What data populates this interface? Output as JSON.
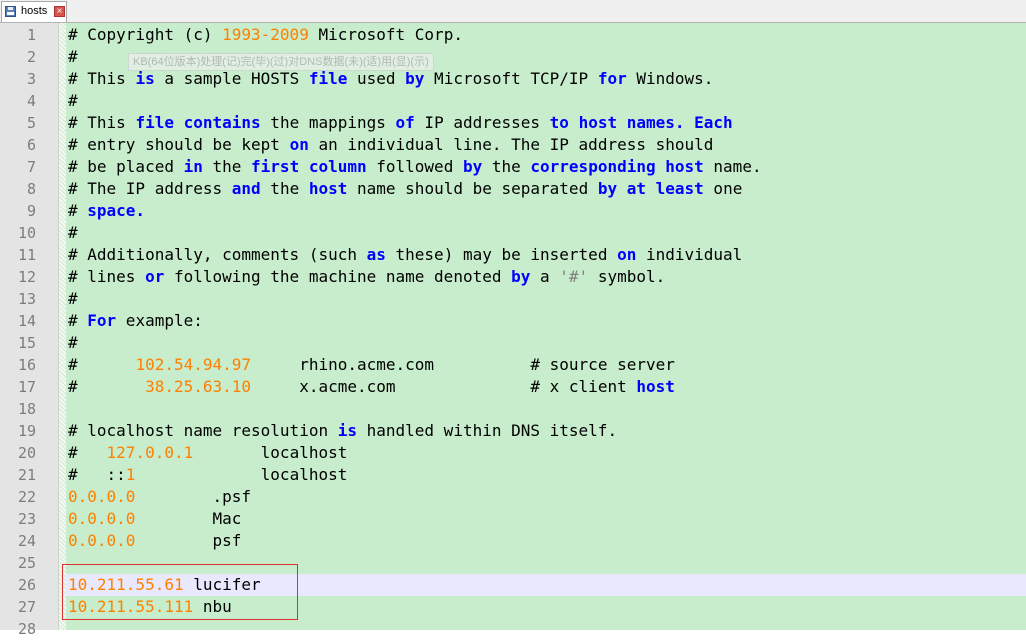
{
  "tab": {
    "title": "hosts",
    "close_glyph": "×"
  },
  "tooltip": "KB(64位版本)处理(记)完(毕)(过)对DNS数据(未)(适)用(显)(示)",
  "colors": {
    "editor_bg": "#c7edcc",
    "gutter_bg": "#e4e4e4",
    "keyword": "#0000ff",
    "number": "#ff8000",
    "highlight_line": "#e8e8ff",
    "annotation_box": "#e03030"
  },
  "lines": [
    {
      "n": "1",
      "segs": [
        [
          "t",
          "# Copyright (c) "
        ],
        [
          "num",
          "1993-2009"
        ],
        [
          "t",
          " Microsoft Corp."
        ]
      ]
    },
    {
      "n": "2",
      "segs": [
        [
          "t",
          "#"
        ]
      ]
    },
    {
      "n": "3",
      "segs": [
        [
          "t",
          "# This "
        ],
        [
          "kw",
          "is"
        ],
        [
          "t",
          " a sample HOSTS "
        ],
        [
          "kw",
          "file"
        ],
        [
          "t",
          " used "
        ],
        [
          "kw",
          "by"
        ],
        [
          "t",
          " Microsoft TCP/IP "
        ],
        [
          "kw",
          "for"
        ],
        [
          "t",
          " Windows."
        ]
      ]
    },
    {
      "n": "4",
      "segs": [
        [
          "t",
          "#"
        ]
      ]
    },
    {
      "n": "5",
      "segs": [
        [
          "t",
          "# This "
        ],
        [
          "kw",
          "file contains"
        ],
        [
          "t",
          " the mappings "
        ],
        [
          "kw",
          "of"
        ],
        [
          "t",
          " IP addresses "
        ],
        [
          "kw",
          "to"
        ],
        [
          "t",
          " "
        ],
        [
          "kw",
          "host names. Each"
        ]
      ]
    },
    {
      "n": "6",
      "segs": [
        [
          "t",
          "# entry should be kept "
        ],
        [
          "kw",
          "on"
        ],
        [
          "t",
          " an individual line. The IP address should"
        ]
      ]
    },
    {
      "n": "7",
      "segs": [
        [
          "t",
          "# be placed "
        ],
        [
          "kw",
          "in"
        ],
        [
          "t",
          " the "
        ],
        [
          "kw",
          "first column"
        ],
        [
          "t",
          " followed "
        ],
        [
          "kw",
          "by"
        ],
        [
          "t",
          " the "
        ],
        [
          "kw",
          "corresponding host"
        ],
        [
          "t",
          " name."
        ]
      ]
    },
    {
      "n": "8",
      "segs": [
        [
          "t",
          "# The IP address "
        ],
        [
          "kw",
          "and"
        ],
        [
          "t",
          " the "
        ],
        [
          "kw",
          "host"
        ],
        [
          "t",
          " name should be separated "
        ],
        [
          "kw",
          "by at least"
        ],
        [
          "t",
          " one"
        ]
      ]
    },
    {
      "n": "9",
      "segs": [
        [
          "t",
          "# "
        ],
        [
          "kw",
          "space."
        ]
      ]
    },
    {
      "n": "10",
      "segs": [
        [
          "t",
          "#"
        ]
      ]
    },
    {
      "n": "11",
      "segs": [
        [
          "t",
          "# Additionally, comments (such "
        ],
        [
          "kw",
          "as"
        ],
        [
          "t",
          " these) may be inserted "
        ],
        [
          "kw",
          "on"
        ],
        [
          "t",
          " individual"
        ]
      ]
    },
    {
      "n": "12",
      "segs": [
        [
          "t",
          "# lines "
        ],
        [
          "kw",
          "or"
        ],
        [
          "t",
          " following the machine name denoted "
        ],
        [
          "kw",
          "by"
        ],
        [
          "t",
          " a "
        ],
        [
          "str",
          "'#'"
        ],
        [
          "t",
          " symbol."
        ]
      ]
    },
    {
      "n": "13",
      "segs": [
        [
          "t",
          "#"
        ]
      ]
    },
    {
      "n": "14",
      "segs": [
        [
          "t",
          "# "
        ],
        [
          "kw",
          "For"
        ],
        [
          "t",
          " example:"
        ]
      ]
    },
    {
      "n": "15",
      "segs": [
        [
          "t",
          "#"
        ]
      ]
    },
    {
      "n": "16",
      "segs": [
        [
          "t",
          "#      "
        ],
        [
          "num",
          "102.54.94.97"
        ],
        [
          "t",
          "     rhino.acme.com          # source server"
        ]
      ]
    },
    {
      "n": "17",
      "segs": [
        [
          "t",
          "#       "
        ],
        [
          "num",
          "38.25.63.10"
        ],
        [
          "t",
          "     x.acme.com              # x client "
        ],
        [
          "kw",
          "host"
        ]
      ]
    },
    {
      "n": "18",
      "segs": []
    },
    {
      "n": "19",
      "segs": [
        [
          "t",
          "# localhost name resolution "
        ],
        [
          "kw",
          "is"
        ],
        [
          "t",
          " handled within DNS itself."
        ]
      ]
    },
    {
      "n": "20",
      "segs": [
        [
          "t",
          "#   "
        ],
        [
          "num",
          "127.0.0.1"
        ],
        [
          "t",
          "       localhost"
        ]
      ]
    },
    {
      "n": "21",
      "segs": [
        [
          "t",
          "#   ::"
        ],
        [
          "num",
          "1"
        ],
        [
          "t",
          "             localhost"
        ]
      ]
    },
    {
      "n": "22",
      "segs": [
        [
          "num",
          "0.0.0.0"
        ],
        [
          "t",
          "        .psf"
        ]
      ]
    },
    {
      "n": "23",
      "segs": [
        [
          "num",
          "0.0.0.0"
        ],
        [
          "t",
          "        Mac"
        ]
      ]
    },
    {
      "n": "24",
      "segs": [
        [
          "num",
          "0.0.0.0"
        ],
        [
          "t",
          "        psf"
        ]
      ]
    },
    {
      "n": "25",
      "segs": []
    },
    {
      "n": "26",
      "segs": [
        [
          "num",
          "10.211.55.61"
        ],
        [
          "t",
          " lucifer"
        ]
      ],
      "highlight": true
    },
    {
      "n": "27",
      "segs": [
        [
          "num",
          "10.211.55.111"
        ],
        [
          "t",
          " nbu"
        ]
      ]
    },
    {
      "n": "28",
      "segs": []
    }
  ]
}
